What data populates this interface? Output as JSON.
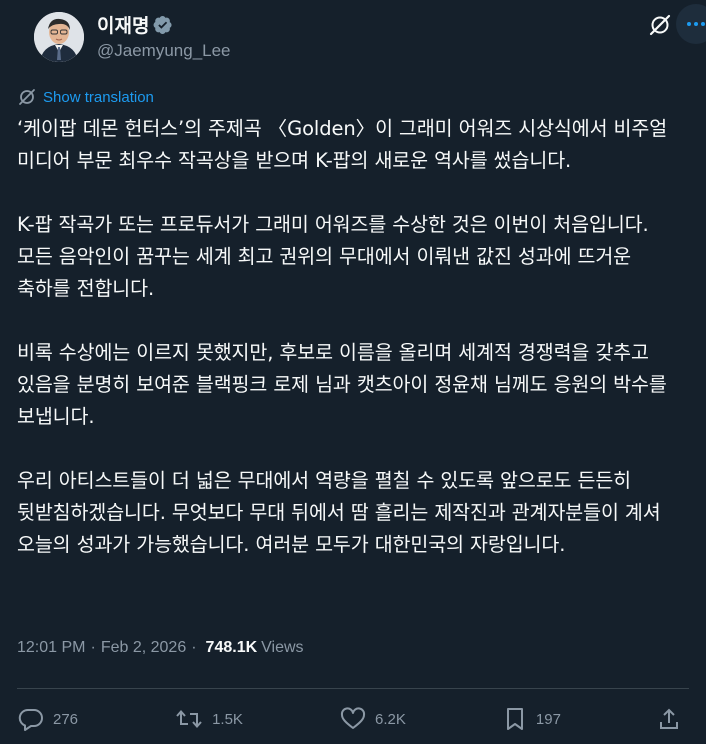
{
  "author": {
    "display_name": "이재명",
    "handle": "@Jaemyung_Lee"
  },
  "translation": {
    "label": "Show translation"
  },
  "post": {
    "paragraphs": [
      "‘케이팝 데몬 헌터스’의 주제곡 〈Golden〉이 그래미 어워즈 시상식에서 비주얼 미디어 부문 최우수 작곡상을 받으며 K-팝의 새로운 역사를 썼습니다.",
      "K-팝 작곡가 또는 프로듀서가 그래미 어워즈를 수상한 것은 이번이 처음입니다. 모든 음악인이 꿈꾸는 세계 최고 권위의 무대에서 이뤄낸 값진 성과에 뜨거운 축하를 전합니다.",
      "비록 수상에는 이르지 못했지만, 후보로 이름을 올리며 세계적 경쟁력을 갖추고 있음을 분명히 보여준 블랙핑크 로제 님과 캣츠아이 정윤채 님께도 응원의 박수를 보냅니다.",
      "우리 아티스트들이 더 넓은 무대에서 역량을 펼칠 수 있도록 앞으로도 든든히 뒷받침하겠습니다. 무엇보다 무대 뒤에서 땀 흘리는 제작진과 관계자분들이 계셔 오늘의 성과가 가능했습니다. 여러분 모두가 대한민국의 자랑입니다."
    ]
  },
  "meta": {
    "time": "12:01 PM",
    "separator": "·",
    "date": "Feb 2, 2026",
    "views_count": "748.1K",
    "views_label": "Views"
  },
  "actions": {
    "replies": "276",
    "reposts": "1.5K",
    "likes": "6.2K",
    "bookmarks": "197"
  },
  "colors": {
    "background": "#15202b",
    "accent": "#1d9bf0",
    "muted": "#8b98a5",
    "text": "#f7f9f9"
  }
}
